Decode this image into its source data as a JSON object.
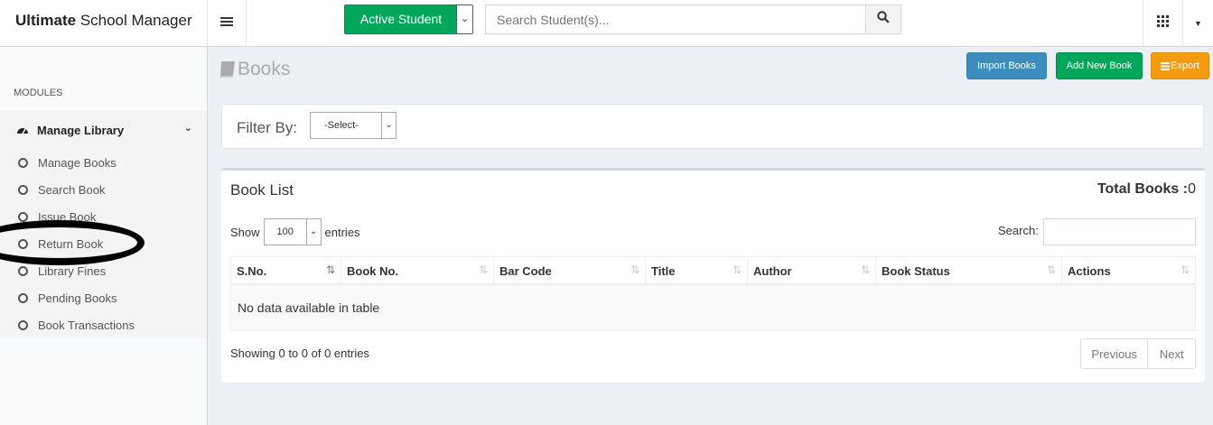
{
  "header": {
    "brand_bold": "Ultimate",
    "brand_rest": "School Manager",
    "student_button": "Active Student",
    "search_placeholder": "Search Student(s)..."
  },
  "sidebar": {
    "section_label": "MODULES",
    "group_label": "Manage Library",
    "items": [
      {
        "label": "Manage Books"
      },
      {
        "label": "Search Book"
      },
      {
        "label": "Issue Book"
      },
      {
        "label": "Return Book"
      },
      {
        "label": "Library Fines"
      },
      {
        "label": "Pending Books"
      },
      {
        "label": "Book Transactions"
      }
    ]
  },
  "page": {
    "title": "Books",
    "buttons": {
      "import": "Import Books",
      "add": "Add New Book",
      "export": "Export"
    }
  },
  "filter": {
    "label": "Filter By:",
    "selected": "-Select-"
  },
  "list": {
    "title": "Book List",
    "total_label": "Total Books :",
    "total_value": "0",
    "show_label": "Show",
    "show_value": "100",
    "entries_label": "entries",
    "search_label": "Search:",
    "columns": [
      "S.No.",
      "Book No.",
      "Bar Code",
      "Title",
      "Author",
      "Book Status",
      "Actions"
    ],
    "empty_message": "No data available in table",
    "info": "Showing 0 to 0 of 0 entries",
    "prev": "Previous",
    "next": "Next"
  },
  "colors": {
    "green": "#00a65a",
    "blue": "#3c8dbc",
    "orange": "#f39c12",
    "annotation": "#000000"
  }
}
